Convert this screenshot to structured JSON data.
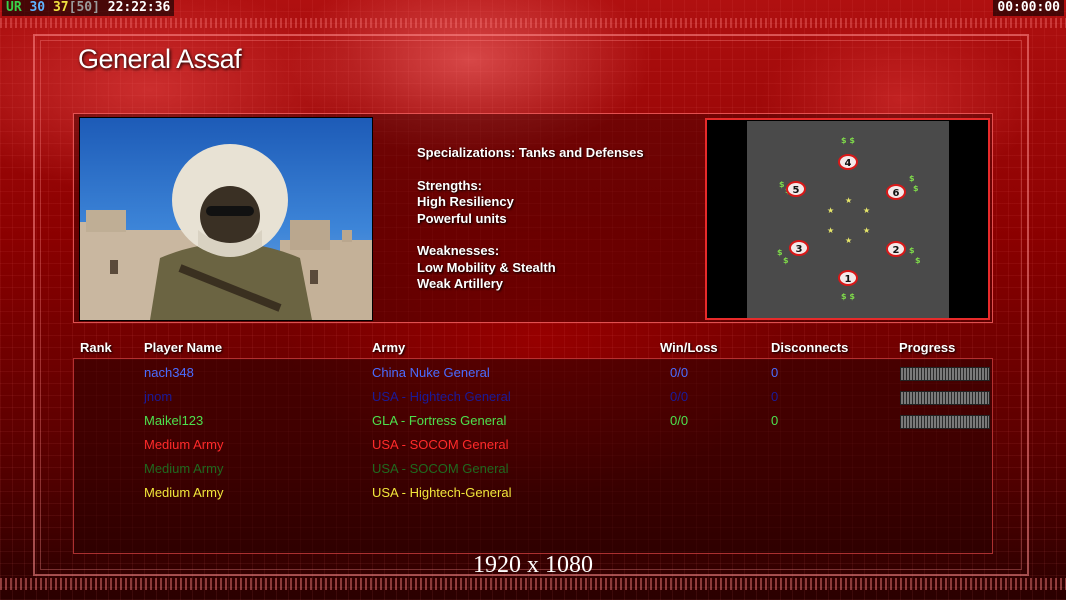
{
  "hud": {
    "left": [
      {
        "text": "UR",
        "color": "#39d24a"
      },
      {
        "text": " 30",
        "color": "#5fb4ff"
      },
      {
        "text": " 37",
        "color": "#f0e040"
      },
      {
        "text": "[50]",
        "color": "#9a9a9a"
      },
      {
        "text": " 22:22:36",
        "color": "#ffffff"
      }
    ],
    "right": "00:00:00"
  },
  "general": {
    "name": "General Assaf",
    "specializations": "Specializations: Tanks and Defenses",
    "strengths_title": "Strengths:",
    "strengths": [
      "High Resiliency",
      "Powerful units"
    ],
    "weaknesses_title": "Weaknesses:",
    "weaknesses": [
      "Low Mobility & Stealth",
      "Weak Artillery"
    ]
  },
  "map": {
    "start_positions": [
      "4",
      "5",
      "6",
      "3",
      "2",
      "1"
    ],
    "resource_icon": "dollar-icon"
  },
  "table": {
    "headers": {
      "rank": "Rank",
      "player": "Player Name",
      "army": "Army",
      "winloss": "Win/Loss",
      "disconnects": "Disconnects",
      "progress": "Progress"
    },
    "rows": [
      {
        "player": "nach348",
        "army": "China Nuke General",
        "winloss": "0/0",
        "disconnects": "0",
        "color": "#4a6cff",
        "progress": true
      },
      {
        "player": "jnom",
        "army": "USA - Hightech General",
        "winloss": "0/0",
        "disconnects": "0",
        "color": "#1a1a9a",
        "progress": true
      },
      {
        "player": "Maikel123",
        "army": "GLA - Fortress General",
        "winloss": "0/0",
        "disconnects": "0",
        "color": "#4de04d",
        "progress": true
      },
      {
        "player": "Medium Army",
        "army": "USA - SOCOM General",
        "winloss": "",
        "disconnects": "",
        "color": "#ff2a2a",
        "progress": false
      },
      {
        "player": "Medium Army",
        "army": "USA - SOCOM General",
        "winloss": "",
        "disconnects": "",
        "color": "#1f6a1f",
        "progress": false
      },
      {
        "player": "Medium Army",
        "army": "USA - Hightech-General",
        "winloss": "",
        "disconnects": "",
        "color": "#f2e63a",
        "progress": false
      }
    ]
  },
  "resolution": "1920 x 1080"
}
